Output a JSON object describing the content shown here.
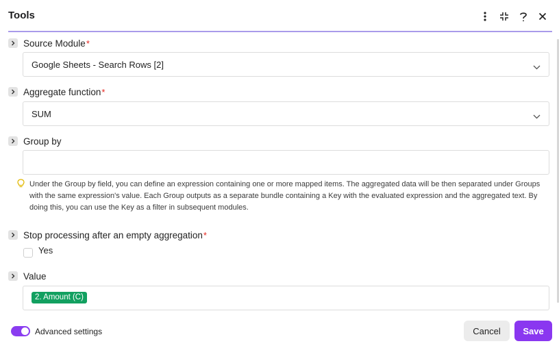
{
  "header": {
    "title": "Tools",
    "icons": [
      "more-vertical-icon",
      "collapse-icon",
      "help-icon",
      "close-icon"
    ],
    "accent_color": "#a99bea"
  },
  "fields": {
    "source_module": {
      "label": "Source Module",
      "required_mark": "*",
      "value": "Google Sheets - Search Rows [2]"
    },
    "aggregate_function": {
      "label": "Aggregate function",
      "required_mark": "*",
      "value": "SUM"
    },
    "group_by": {
      "label": "Group by",
      "value": "",
      "hint": "Under the Group by field, you can define an expression containing one or more mapped items. The aggregated data will be then separated under Groups with the same expression's value. Each Group outputs as a separate bundle containing a Key with the evaluated expression and the aggregated text. By doing this, you can use the Key as a filter in subsequent modules."
    },
    "stop_processing": {
      "label": "Stop processing after an empty aggregation",
      "required_mark": "*",
      "checkbox_label": "Yes",
      "checked": false
    },
    "value": {
      "label": "Value",
      "pill": "2. Amount (C)",
      "pill_color": "#12a060"
    }
  },
  "footer": {
    "advanced_settings_label": "Advanced settings",
    "advanced_settings_on": true,
    "cancel_label": "Cancel",
    "save_label": "Save",
    "save_color": "#8a37f0"
  }
}
